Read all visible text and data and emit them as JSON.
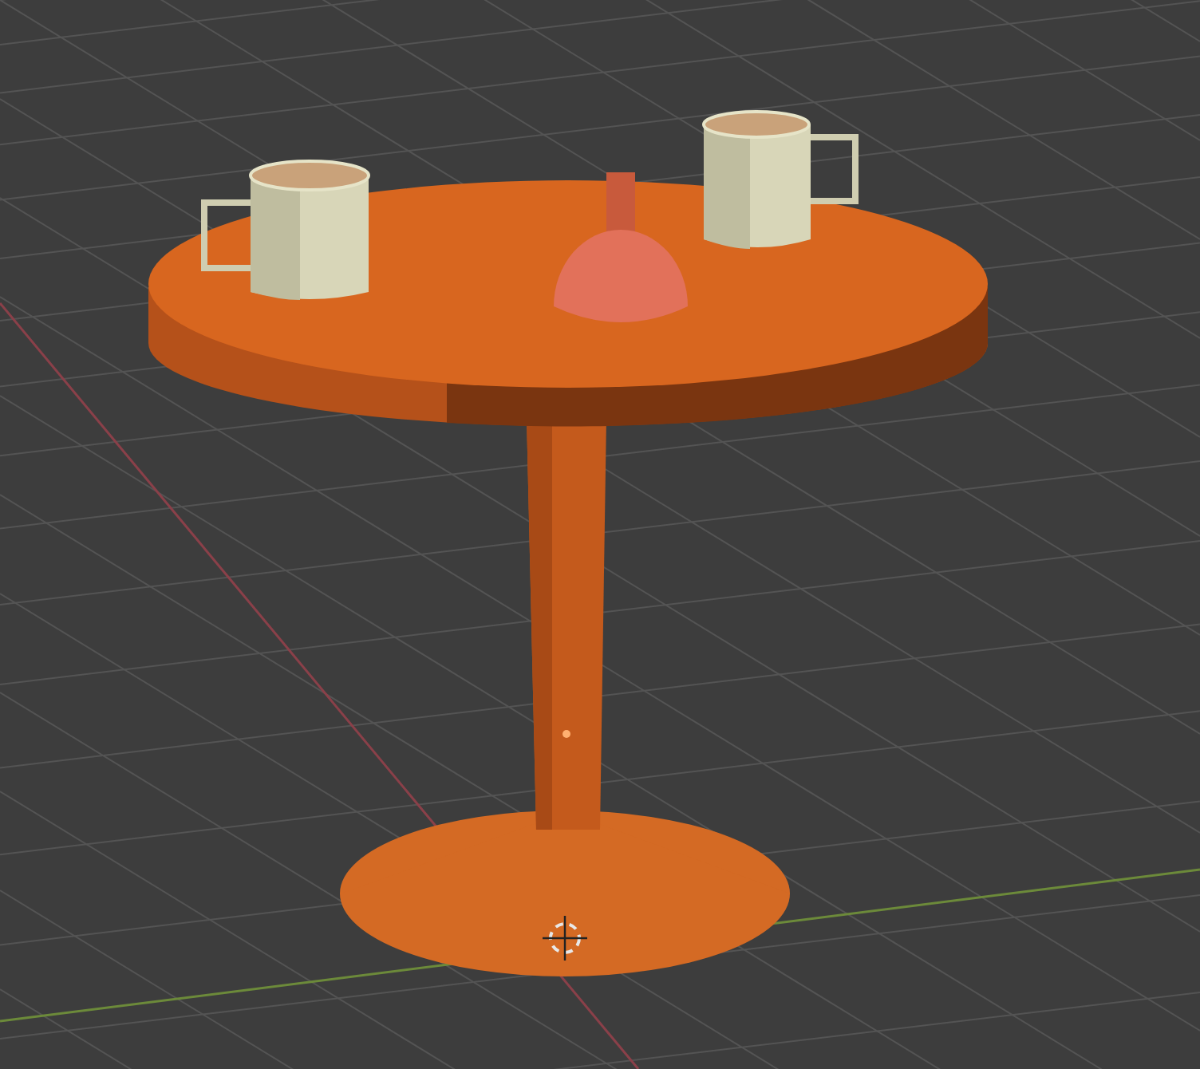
{
  "viewport": {
    "grid": true,
    "cursor_3d": true,
    "origin_dot": true
  }
}
